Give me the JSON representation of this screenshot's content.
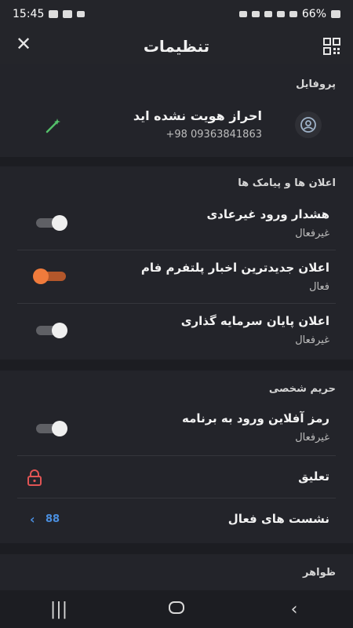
{
  "status_bar": {
    "time": "15:45",
    "battery": "66%"
  },
  "app_bar": {
    "title": "تنظیمات",
    "close_glyph": "✕"
  },
  "profile": {
    "section_title": "پروفایل",
    "name": "احراز هویت نشده اید",
    "phone": "+98 09363841863"
  },
  "notifications": {
    "section_title": "اعلان ها و پیامک ها",
    "items": [
      {
        "label": "هشدار ورود غیرعادی",
        "status": "غیرفعال",
        "enabled": false
      },
      {
        "label": "اعلان جدیدترین اخبار پلتفرم فام",
        "status": "فعال",
        "enabled": true
      },
      {
        "label": "اعلان پایان سرمایه گذاری",
        "status": "غیرفعال",
        "enabled": false
      }
    ]
  },
  "privacy": {
    "section_title": "حریم شخصی",
    "offline_password": {
      "label": "رمز آفلاین ورود به برنامه",
      "status": "غیرفعال",
      "enabled": false
    },
    "suspend": {
      "label": "تعلیق"
    },
    "active_sessions": {
      "label": "نشست های فعال",
      "count": "88"
    }
  },
  "appearance": {
    "section_title": "ظواهر"
  },
  "colors": {
    "accent": "#f07b3c",
    "lock": "#e05454",
    "link": "#4a8fe0",
    "magic": "#54c06a"
  }
}
